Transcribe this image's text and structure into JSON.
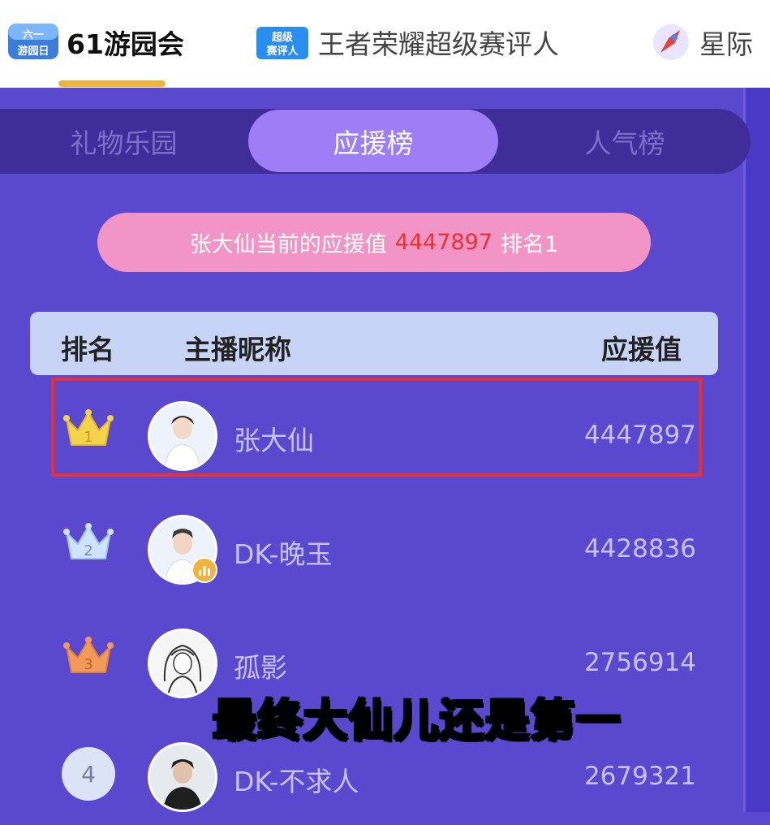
{
  "top_tabs": [
    {
      "label": "61游园会",
      "logo_text": "六一游园日",
      "active": true
    },
    {
      "label": "王者荣耀超级赛评人",
      "logo_text": "超级赛评人",
      "active": false
    },
    {
      "label": "星际",
      "active": false
    }
  ],
  "segments": [
    {
      "label": "礼物乐园",
      "active": false
    },
    {
      "label": "应援榜",
      "active": true
    },
    {
      "label": "人气榜",
      "active": false
    }
  ],
  "banner": {
    "prefix": "张大仙当前的应援值",
    "value": "4447897",
    "rank_text": "排名1"
  },
  "table_header": {
    "rank": "排名",
    "nickname": "主播昵称",
    "support": "应援值"
  },
  "rows": [
    {
      "rank": "1",
      "name": "张大仙",
      "value": "4447897",
      "badge": "crown-gold"
    },
    {
      "rank": "2",
      "name": "DK-晚玉",
      "value": "4428836",
      "badge": "crown-silver"
    },
    {
      "rank": "3",
      "name": "孤影",
      "value": "2756914",
      "badge": "crown-bronze"
    },
    {
      "rank": "4",
      "name": "DK-不求人",
      "value": "2679321",
      "badge": "circle"
    }
  ],
  "caption": "最终大仙儿还是第一",
  "colors": {
    "background": "#5a48cf",
    "accent": "#f0b43c",
    "highlight": "#ee2d2d",
    "caption": "#fff222"
  }
}
